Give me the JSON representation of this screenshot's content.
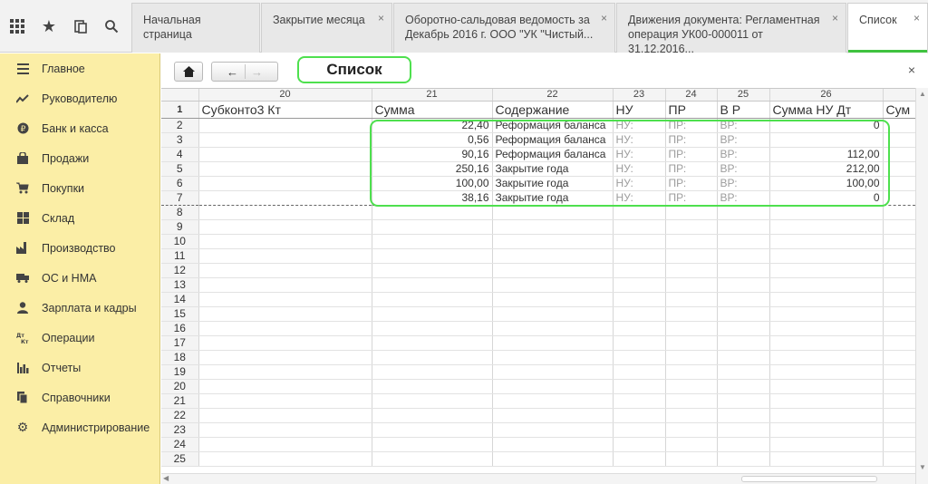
{
  "toolbar": {
    "icons": [
      "apps-grid-icon",
      "star-icon",
      "history-icon",
      "search-icon"
    ]
  },
  "tabs": [
    {
      "label": "Начальная страница",
      "closable": false
    },
    {
      "label": "Закрытие месяца",
      "closable": true
    },
    {
      "label": "Оборотно-сальдовая ведомость за Декабрь 2016 г. ООО \"УК \"Чистый...",
      "closable": true
    },
    {
      "label": "Движения документа: Регламентная операция УК00-000011 от 31.12.2016...",
      "closable": true
    },
    {
      "label": "Список",
      "closable": true,
      "active": true
    }
  ],
  "sidebar": {
    "items": [
      {
        "label": "Главное",
        "icon": "menu-lines-icon"
      },
      {
        "label": "Руководителю",
        "icon": "trend-chart-icon"
      },
      {
        "label": "Банк и касса",
        "icon": "coin-icon"
      },
      {
        "label": "Продажи",
        "icon": "shopping-bag-icon"
      },
      {
        "label": "Покупки",
        "icon": "cart-icon"
      },
      {
        "label": "Склад",
        "icon": "warehouse-grid-icon"
      },
      {
        "label": "Производство",
        "icon": "factory-icon"
      },
      {
        "label": "ОС и НМА",
        "icon": "truck-icon"
      },
      {
        "label": "Зарплата и кадры",
        "icon": "person-icon"
      },
      {
        "label": "Операции",
        "icon": "debit-credit-icon"
      },
      {
        "label": "Отчеты",
        "icon": "bar-chart-icon"
      },
      {
        "label": "Справочники",
        "icon": "books-icon"
      },
      {
        "label": "Администрирование",
        "icon": "gear-icon"
      }
    ]
  },
  "window": {
    "title": "Список",
    "home_icon": "⌂",
    "back_icon": "←",
    "forward_icon": "→",
    "close_icon": "×"
  },
  "grid": {
    "column_numbers": [
      "20",
      "21",
      "22",
      "23",
      "24",
      "25",
      "26"
    ],
    "headers": [
      "Субконто3 Кт",
      "Сумма",
      "Содержание",
      "НУ",
      "ПР",
      "В Р",
      "Сумма НУ Дт",
      "Сум"
    ],
    "header_row_number": "1",
    "rows": [
      {
        "n": "2",
        "sum": "22,40",
        "content": "Реформация баланса",
        "nu": "НУ:",
        "pr": "ПР:",
        "vr": "ВР:",
        "sum_nu_dt": "0"
      },
      {
        "n": "3",
        "sum": "0,56",
        "content": "Реформация баланса",
        "nu": "НУ:",
        "pr": "ПР:",
        "vr": "ВР:",
        "sum_nu_dt": ""
      },
      {
        "n": "4",
        "sum": "90,16",
        "content": "Реформация баланса",
        "nu": "НУ:",
        "pr": "ПР:",
        "vr": "ВР:",
        "sum_nu_dt": "112,00"
      },
      {
        "n": "5",
        "sum": "250,16",
        "content": "Закрытие года",
        "nu": "НУ:",
        "pr": "ПР:",
        "vr": "ВР:",
        "sum_nu_dt": "212,00"
      },
      {
        "n": "6",
        "sum": "100,00",
        "content": "Закрытие года",
        "nu": "НУ:",
        "pr": "ПР:",
        "vr": "ВР:",
        "sum_nu_dt": "100,00"
      },
      {
        "n": "7",
        "sum": "38,16",
        "content": "Закрытие года",
        "nu": "НУ:",
        "pr": "ПР:",
        "vr": "ВР:",
        "sum_nu_dt": "0"
      }
    ],
    "empty_row_numbers": [
      "8",
      "9",
      "10",
      "11",
      "12",
      "13",
      "14",
      "15",
      "16",
      "17",
      "18",
      "19",
      "20",
      "21",
      "22",
      "23",
      "24",
      "25"
    ]
  },
  "colors": {
    "sidebar_bg": "#fbeea6",
    "highlight": "#4ee04e",
    "active_tab_accent": "#3fc23f"
  }
}
